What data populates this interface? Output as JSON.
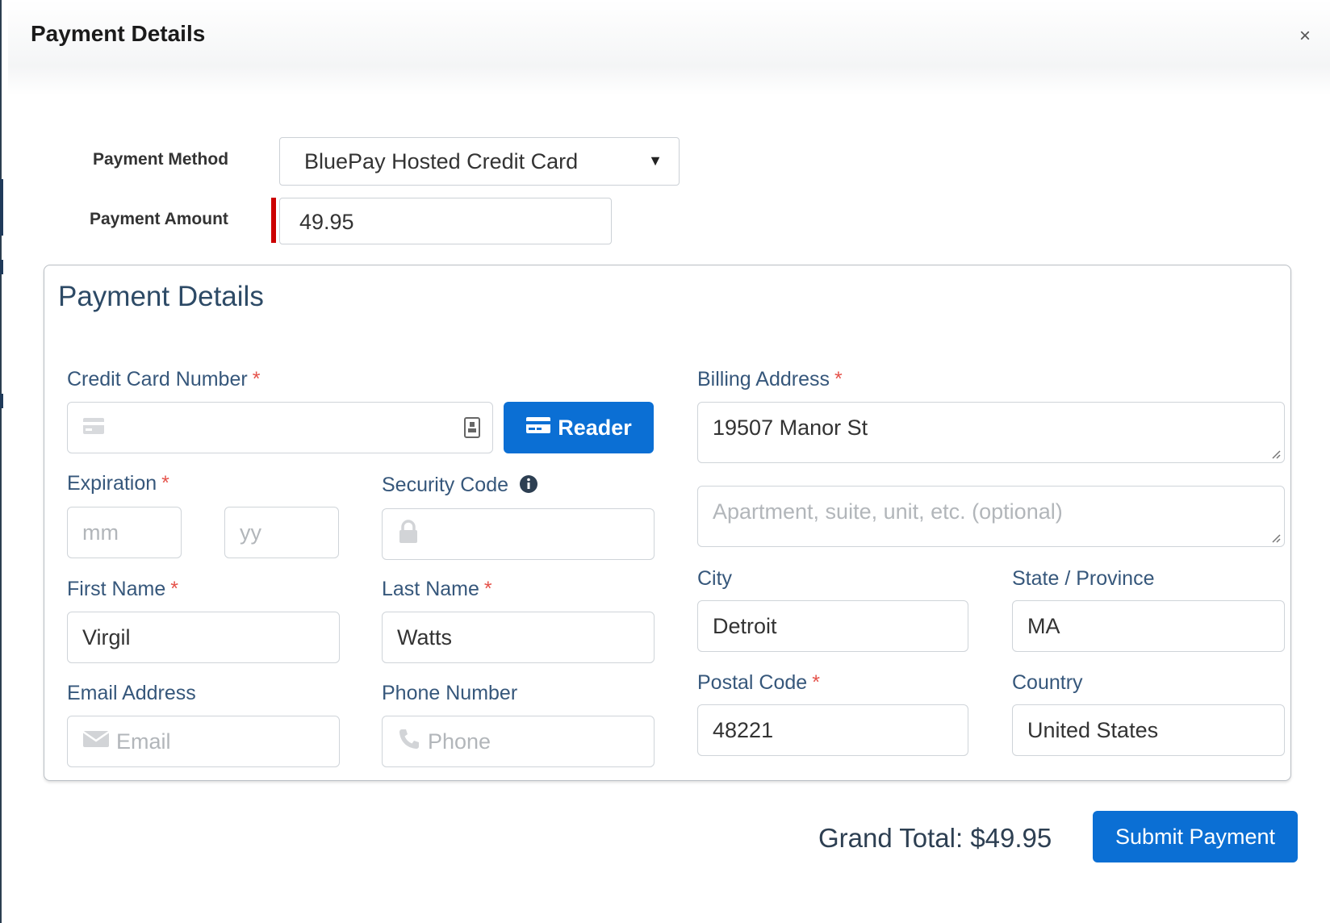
{
  "modal": {
    "title": "Payment Details",
    "close_label": "×"
  },
  "payment_method": {
    "label": "Payment Method",
    "selected": "BluePay Hosted Credit Card"
  },
  "payment_amount": {
    "label": "Payment Amount",
    "value": "49.95"
  },
  "details": {
    "title": "Payment Details",
    "credit_card": {
      "label": "Credit Card Number",
      "required": "*",
      "value": ""
    },
    "reader_button": "Reader",
    "expiration": {
      "label": "Expiration",
      "required": "*",
      "month_placeholder": "mm",
      "year_placeholder": "yy"
    },
    "security_code": {
      "label": "Security Code"
    },
    "first_name": {
      "label": "First Name",
      "required": "*",
      "value": "Virgil"
    },
    "last_name": {
      "label": "Last Name",
      "required": "*",
      "value": "Watts"
    },
    "email": {
      "label": "Email Address",
      "placeholder": "Email"
    },
    "phone": {
      "label": "Phone Number",
      "placeholder": "Phone"
    },
    "billing_address": {
      "label": "Billing Address",
      "required": "*",
      "line1": "19507 Manor St",
      "line2_placeholder": "Apartment, suite, unit, etc. (optional)"
    },
    "city": {
      "label": "City",
      "value": "Detroit"
    },
    "state": {
      "label": "State / Province",
      "value": "MA"
    },
    "postal_code": {
      "label": "Postal Code",
      "required": "*",
      "value": "48221"
    },
    "country": {
      "label": "Country",
      "value": "United States"
    }
  },
  "footer": {
    "grand_total": "Grand Total: $49.95",
    "submit_label": "Submit Payment"
  },
  "colors": {
    "accent": "#0b6fd4",
    "label": "#36577b",
    "required": "#e5534b",
    "required_bar": "#cc0000"
  }
}
